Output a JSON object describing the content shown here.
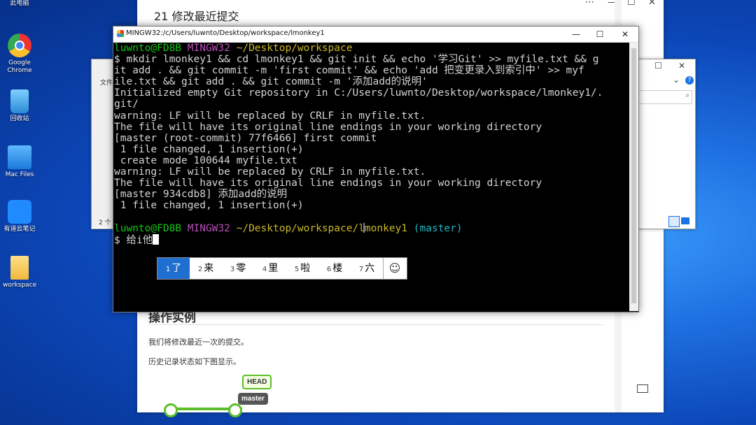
{
  "desktop": {
    "icons": [
      {
        "label": "此电脑"
      },
      {
        "label": "Google Chrome"
      },
      {
        "label": "回收站"
      },
      {
        "label": "Mac Files"
      },
      {
        "label": "有道云笔记"
      },
      {
        "label": "workspace"
      }
    ]
  },
  "doc": {
    "title": "21 修改最近提交",
    "heading": "操作实例",
    "para1": "我们将修改最近一次的提交。",
    "para2": "历史记录状态如下图显示。",
    "head_badge": "HEAD",
    "master_badge": "master"
  },
  "explorer": {
    "menu_label": "文件",
    "status": "2 个"
  },
  "terminal": {
    "title": "MINGW32:/c/Users/luwnto/Desktop/workspace/lmonkey1",
    "prompt1_user": "luwnto@FD8B",
    "prompt1_env": "MINGW32",
    "prompt1_path": "~/Desktop/workspace",
    "lines": [
      "$ mkdir lmonkey1 && cd lmonkey1 && git init && echo '学习Git' >> myfile.txt && g",
      "it add . && git commit -m 'first commit' && echo 'add 把变更录入到索引中' >> myf",
      "ile.txt && git add . && git commit -m '添加add的说明'",
      "Initialized empty Git repository in C:/Users/luwnto/Desktop/workspace/lmonkey1/.",
      "git/",
      "warning: LF will be replaced by CRLF in myfile.txt.",
      "The file will have its original line endings in your working directory",
      "[master (root-commit) 77f6466] first commit",
      " 1 file changed, 1 insertion(+)",
      " create mode 100644 myfile.txt",
      "warning: LF will be replaced by CRLF in myfile.txt.",
      "The file will have its original line endings in your working directory",
      "[master 934cdb8] 添加add的说明",
      " 1 file changed, 1 insertion(+)"
    ],
    "prompt2_user": "luwnto@FD8B",
    "prompt2_env": "MINGW32",
    "prompt2_path": "~/Desktop/workspace/lmonkey1",
    "prompt2_branch": "(master)",
    "input_prefix": "$ ",
    "input_text": "给i他"
  },
  "ime": {
    "candidates": [
      {
        "n": "1",
        "t": "了"
      },
      {
        "n": "2",
        "t": "来"
      },
      {
        "n": "3",
        "t": "零"
      },
      {
        "n": "4",
        "t": "里"
      },
      {
        "n": "5",
        "t": "啦"
      },
      {
        "n": "6",
        "t": "楼"
      },
      {
        "n": "7",
        "t": "六"
      }
    ],
    "emoji": "☺"
  }
}
